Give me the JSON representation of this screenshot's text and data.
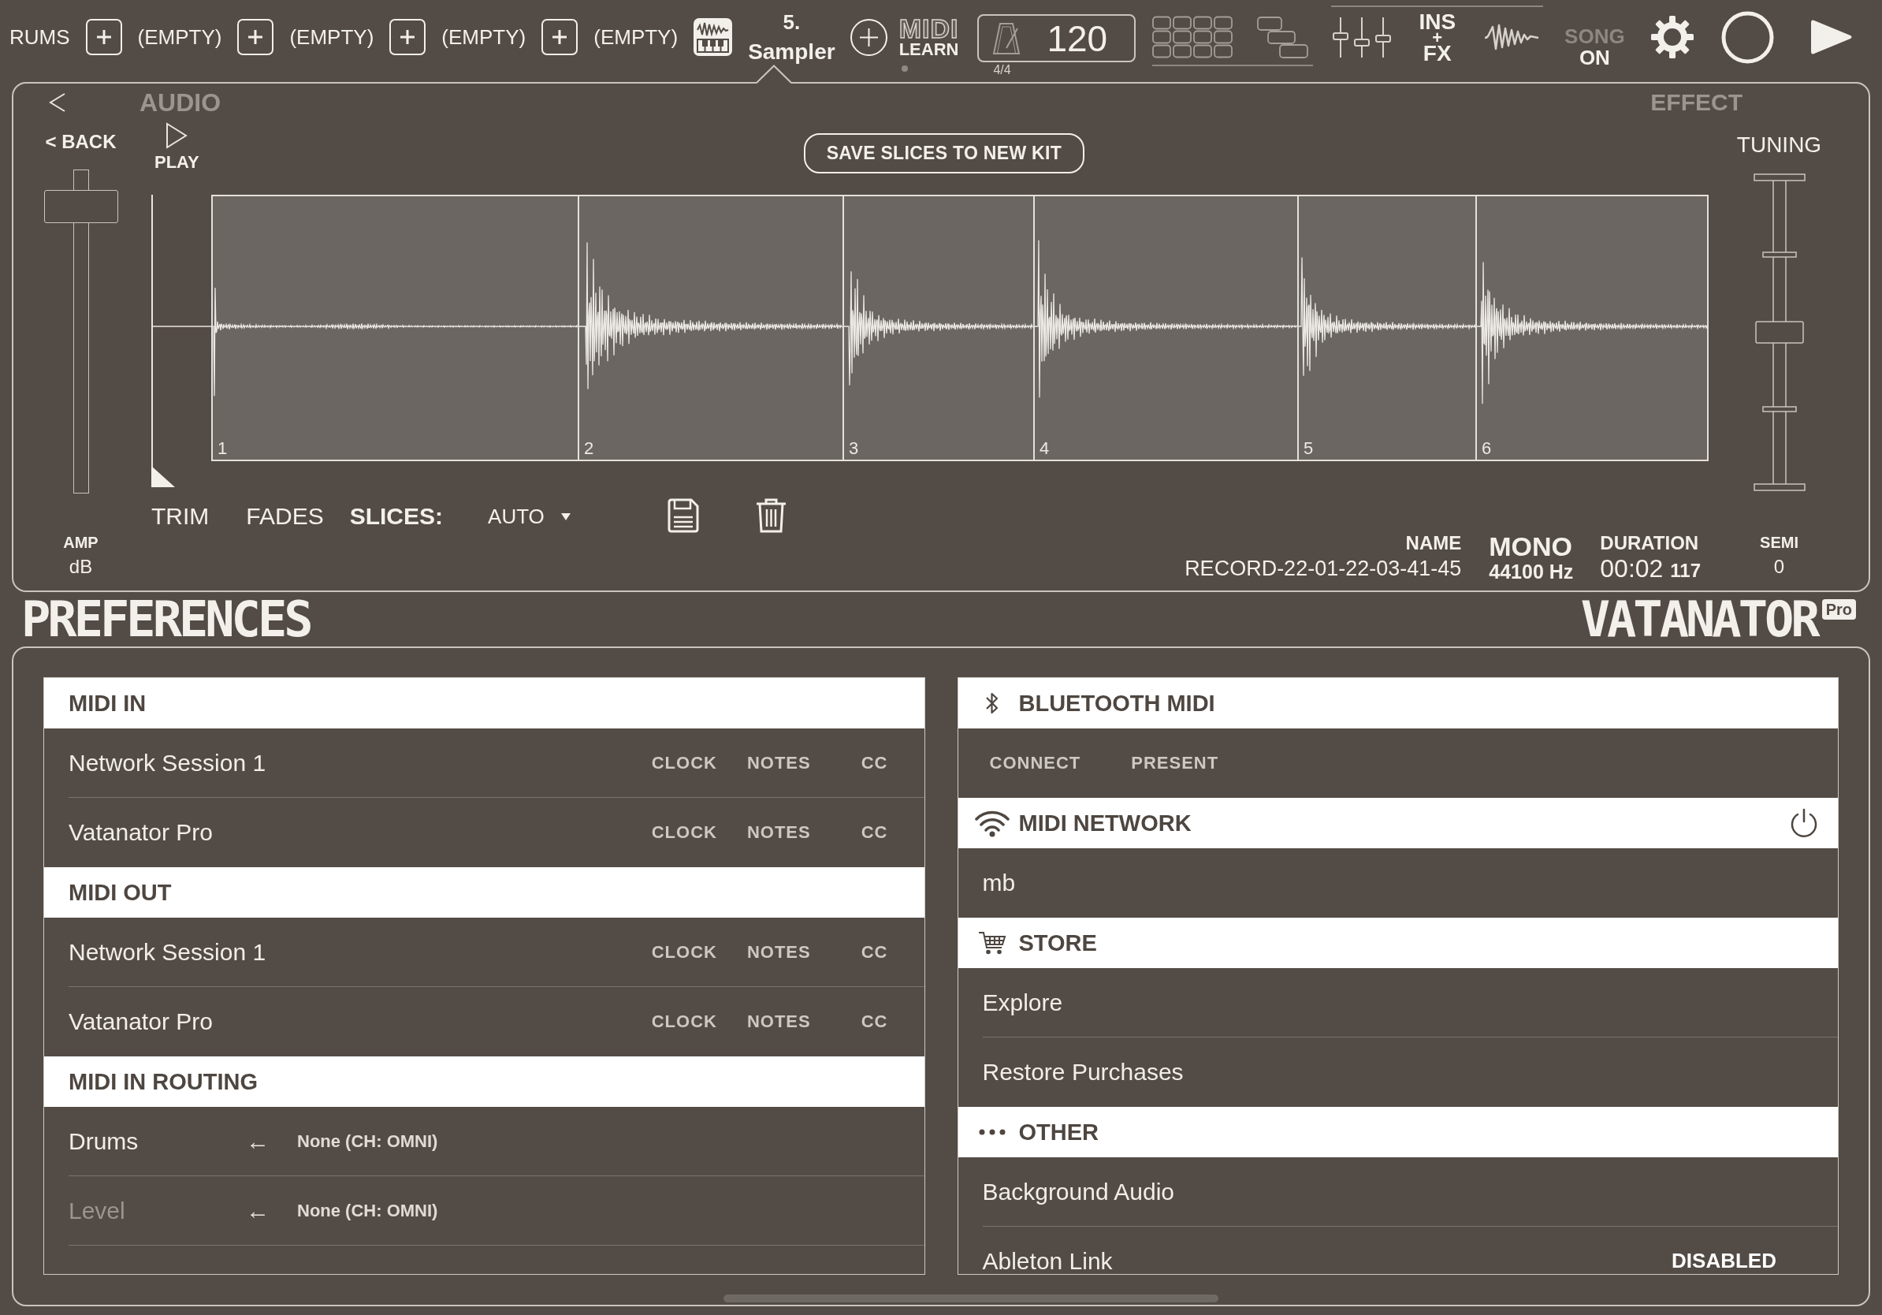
{
  "top_bar": {
    "tracks": [
      {
        "kind": "named",
        "name": "RUMS",
        "selected": false
      },
      {
        "kind": "empty",
        "name": "(EMPTY)",
        "selected": false
      },
      {
        "kind": "empty",
        "name": "(EMPTY)",
        "selected": false
      },
      {
        "kind": "empty",
        "name": "(EMPTY)",
        "selected": false
      },
      {
        "kind": "empty",
        "name": "(EMPTY)",
        "selected": false
      },
      {
        "kind": "sampler",
        "number": "5.",
        "name": "Sampler",
        "selected": true
      }
    ],
    "midi_learn": {
      "logo": "MIDI",
      "label": "LEARN"
    },
    "tempo": {
      "bpm": "120",
      "time_signature": "4/4"
    },
    "ins_fx": [
      "INS",
      "+",
      "FX"
    ],
    "song_mode": {
      "label": "SONG",
      "state": "ON"
    }
  },
  "audio_panel": {
    "headings": [
      "AUDIO",
      "EFFECT"
    ],
    "back_button": "< BACK",
    "play_button": "PLAY",
    "save_slices_button": "SAVE SLICES TO NEW KIT",
    "amp": {
      "label": "AMP",
      "unit": "dB",
      "level": 0.93
    },
    "slices": [
      {
        "label": "1"
      },
      {
        "label": "2"
      },
      {
        "label": "3"
      },
      {
        "label": "4"
      },
      {
        "label": "5"
      },
      {
        "label": "6"
      }
    ],
    "tabs": [
      {
        "label": "TRIM",
        "selected": false
      },
      {
        "label": "FADES",
        "selected": false
      },
      {
        "label": "SLICES:",
        "selected": true
      }
    ],
    "slice_mode": "AUTO",
    "sample": {
      "name_label": "NAME",
      "name": "RECORD-22-01-22-03-41-45",
      "channels": "MONO",
      "sample_rate": "44100 Hz",
      "duration_label": "DURATION",
      "duration": "00:02 **117**"
    },
    "tuning": {
      "label": "TUNING",
      "level": 0.5,
      "unit_label": "SEMI",
      "value": "0"
    }
  },
  "preferences": {
    "title": "PREFERENCES",
    "logo": "VATANATOR",
    "logo_badge": "Pro",
    "left_sections": [
      {
        "kind": "ports",
        "title": "MIDI IN",
        "rows": [
          {
            "name": "Network Session 1",
            "toggles": [
              "CLOCK",
              "NOTES",
              "CC"
            ]
          },
          {
            "name": "Vatanator Pro",
            "toggles": [
              "CLOCK",
              "NOTES",
              "CC"
            ]
          }
        ]
      },
      {
        "kind": "ports",
        "title": "MIDI OUT",
        "rows": [
          {
            "name": "Network Session 1",
            "toggles": [
              "CLOCK",
              "NOTES",
              "CC"
            ]
          },
          {
            "name": "Vatanator Pro",
            "toggles": [
              "CLOCK",
              "NOTES",
              "CC"
            ]
          }
        ]
      },
      {
        "kind": "routing",
        "title": "MIDI IN ROUTING",
        "rows": [
          {
            "name": "Drums",
            "arrow": "←",
            "source": "None (CH: OMNI)",
            "disabled": false
          },
          {
            "name": "Level",
            "arrow": "←",
            "source": "None (CH: OMNI)",
            "disabled": true
          }
        ]
      }
    ],
    "right_sections": [
      {
        "kind": "bluetooth",
        "title": "BLUETOOTH MIDI",
        "buttons": [
          "CONNECT",
          "PRESENT"
        ]
      },
      {
        "kind": "network",
        "title": "MIDI NETWORK",
        "rows": [
          {
            "name": "mb"
          }
        ]
      },
      {
        "kind": "store",
        "title": "STORE",
        "rows": [
          {
            "name": "Explore"
          },
          {
            "name": "Restore Purchases"
          }
        ]
      },
      {
        "kind": "other",
        "title": "OTHER",
        "rows": [
          {
            "name": "Background Audio"
          },
          {
            "name": "Ableton Link",
            "value": "DISABLED"
          }
        ]
      }
    ]
  }
}
